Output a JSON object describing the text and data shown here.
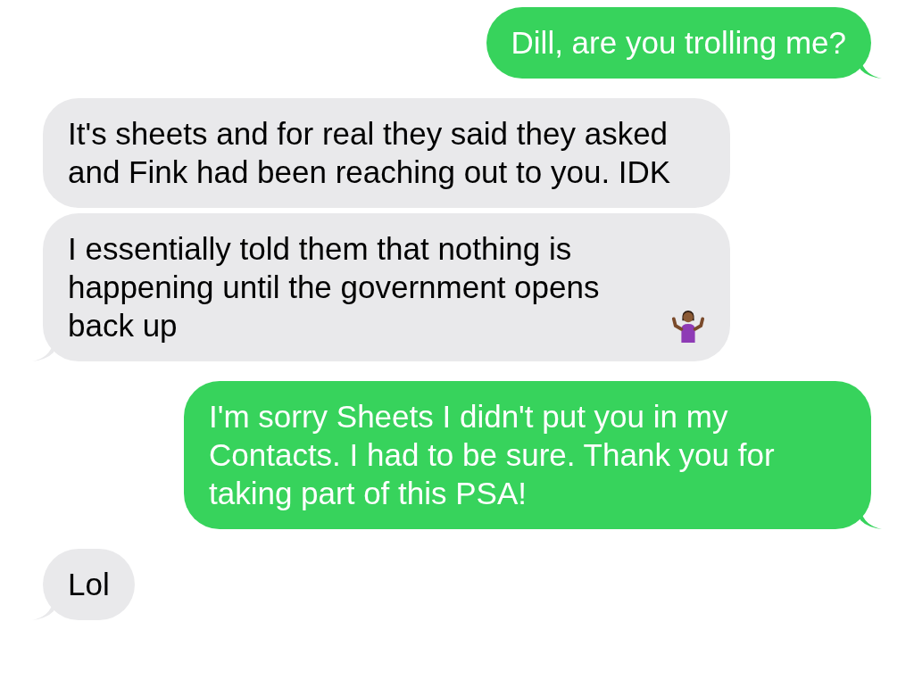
{
  "messages": [
    {
      "kind": "sent",
      "text": "Dill, are you trolling me?",
      "tail": true
    },
    {
      "kind": "received",
      "text": "It's sheets and for real they said they asked and Fink had been reaching out to you. IDK",
      "tail": false
    },
    {
      "kind": "received",
      "text": "I essentially told them that nothing is happening until the government opens back up",
      "tail": true,
      "emoji_after": true
    },
    {
      "kind": "sent",
      "text": "I'm sorry Sheets I didn't put you in my Contacts. I had to be sure. Thank you for taking part of this PSA!",
      "tail": true
    },
    {
      "kind": "received",
      "text": "Lol",
      "tail": true
    }
  ]
}
